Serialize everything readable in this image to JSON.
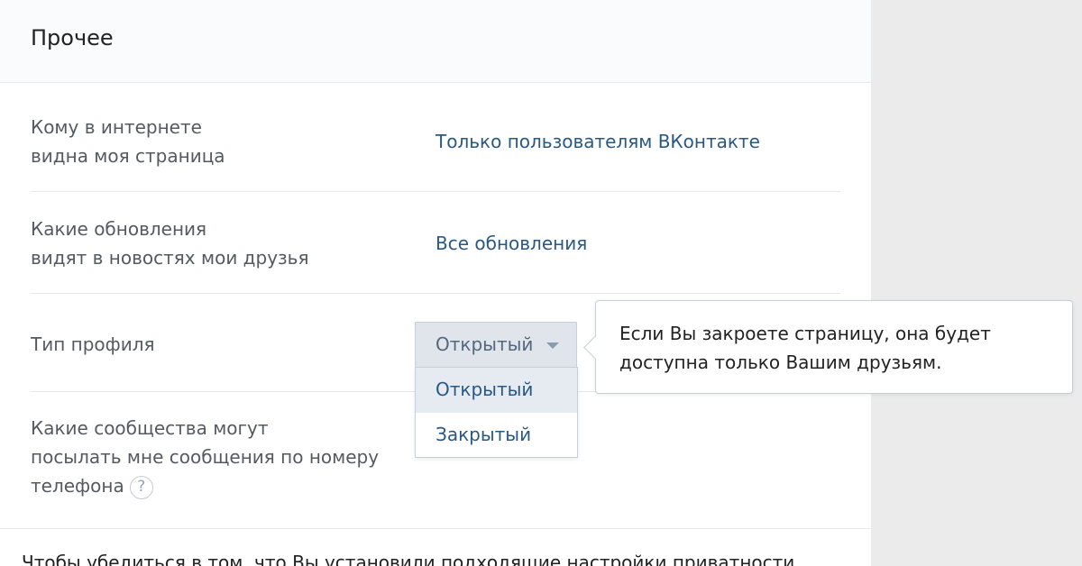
{
  "section": {
    "title": "Прочее"
  },
  "rows": [
    {
      "label_line1": "Кому в интернете",
      "label_line2": "видна моя страница",
      "value": "Только пользователям ВКонтакте"
    },
    {
      "label_line1": "Какие обновления",
      "label_line2": "видят в новостях мои друзья",
      "value": "Все обновления"
    },
    {
      "label_line1": "Тип профиля",
      "select": {
        "selected": "Открытый",
        "options": [
          "Открытый",
          "Закрытый"
        ],
        "highlighted_index": 0
      },
      "tooltip": {
        "line1": "Если Вы закроете страницу, она будет",
        "line2": "доступна только Вашим друзьям."
      }
    },
    {
      "label_line1": "Какие сообщества могут",
      "label_line2": "посылать мне сообщения по номеру",
      "label_line3": "телефона",
      "help_glyph": "?"
    }
  ],
  "footer": {
    "partial_text": "Чтобы убедиться в том, что Вы установили подходящие настройки приватности"
  },
  "colors": {
    "link": "#2a5885",
    "label": "#555a60",
    "title": "#222222",
    "select_bg": "#dfe5eb",
    "dropdown_active": "#e5ebf1",
    "background": "#ebebeb"
  },
  "icons": {
    "select_caret": "caret-down-icon",
    "help": "question-icon"
  }
}
